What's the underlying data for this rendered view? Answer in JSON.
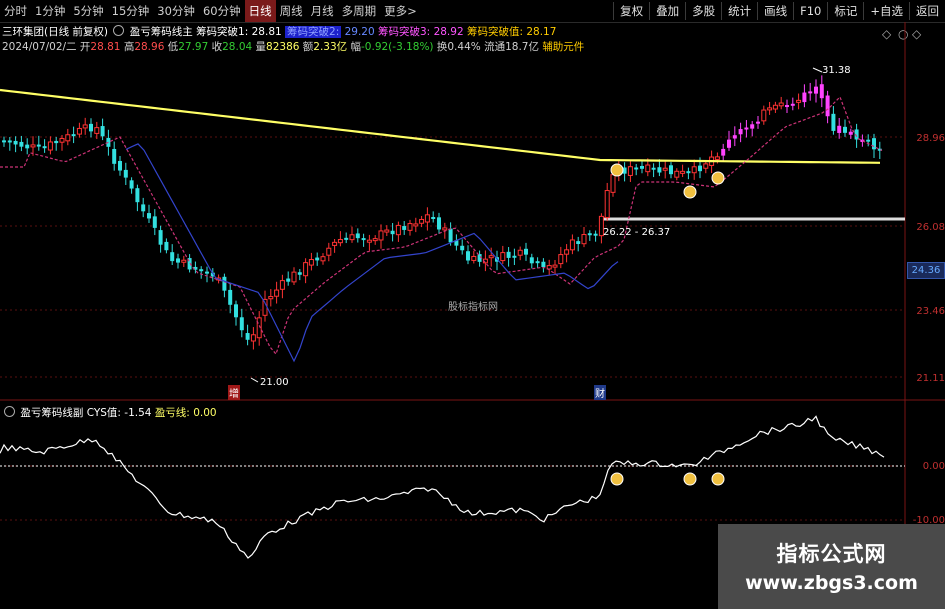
{
  "toolbar": {
    "periods": [
      "分时",
      "1分钟",
      "5分钟",
      "15分钟",
      "30分钟",
      "60分钟",
      "日线",
      "周线",
      "月线",
      "多周期",
      "更多>"
    ],
    "active_period": "日线",
    "right_buttons": [
      "复权",
      "叠加",
      "多股",
      "统计",
      "画线",
      "F10",
      "标记",
      "+自选",
      "返回"
    ]
  },
  "info": {
    "stock": "三环集团(日线 前复权)",
    "indicator": "盈亏筹码线主",
    "breakout1_label": "筹码突破1:",
    "breakout1_value": "28.81",
    "breakout2_label": "筹码突破2:",
    "breakout2_value": "29.20",
    "breakout3_label": "筹码突破3:",
    "breakout3_value": "28.92",
    "breakout_val_label": "筹码突破值:",
    "breakout_val_value": "28.17",
    "date": "2024/07/02/二",
    "open_label": "开",
    "open": "28.81",
    "high_label": "高",
    "high": "28.96",
    "low_label": "低",
    "low": "27.97",
    "close_label": "收",
    "close": "28.04",
    "volume_label": "量",
    "volume": "82386",
    "amount_label": "额",
    "amount": "2.33亿",
    "change_label": "幅",
    "change": "-0.92(-3.18%)",
    "turnover_label": "换",
    "turnover": "0.44%",
    "float_label": "流通",
    "float": "18.7亿",
    "aux_label": "辅助元件"
  },
  "price_axis": [
    "28.96",
    "26.08",
    "23.46",
    "21.11"
  ],
  "last_price_tag": "24.36",
  "annotations": {
    "high_mark": "31.38",
    "low_mark": "21.00",
    "range_mark": "26.22 - 26.37",
    "event_zeng": "增",
    "event_cai": "财",
    "watermark_center": "股标指标网"
  },
  "sub_panel": {
    "name": "盈亏筹码线副",
    "cys_label": "CYS值:",
    "cys_value": "-1.54",
    "line_label": "盈亏线:",
    "line_value": "0.00",
    "axis": [
      "0.00",
      "-10.00"
    ]
  },
  "watermark": {
    "title": "指标公式网",
    "url": "www.zbgs3.com"
  },
  "colors": {
    "up": "#ff3333",
    "down": "#33e0e0",
    "pink_candle": "#ff44ff",
    "ma_yellow": "#ffff66",
    "ma_pink": "#cc3377",
    "ma_blue": "#3344cc"
  }
}
